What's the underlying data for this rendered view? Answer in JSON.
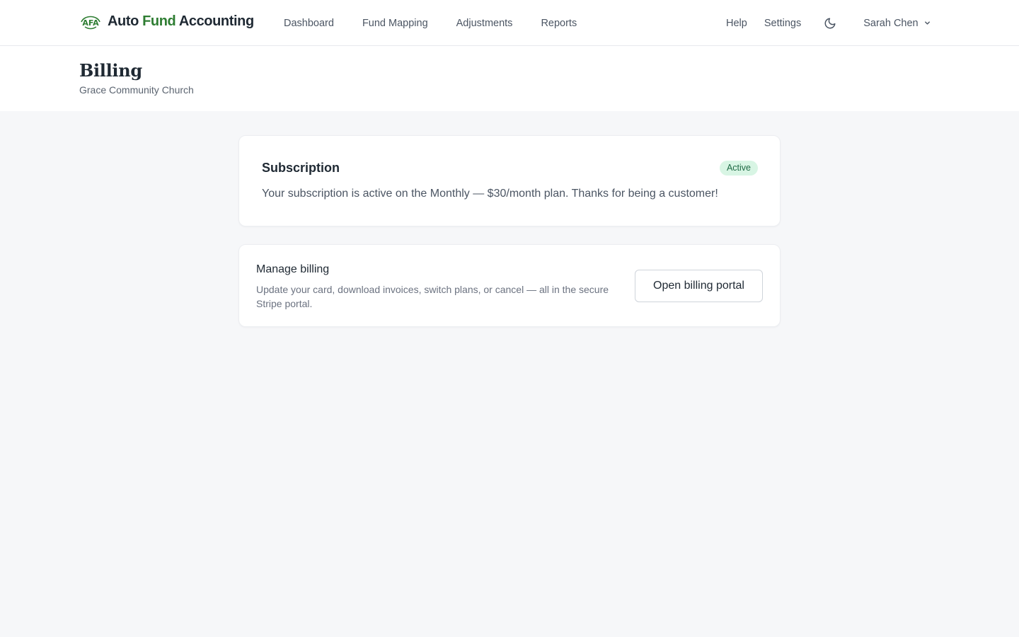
{
  "app": {
    "logo_mark": "AFA",
    "name_part1": "Auto",
    "name_part2": "Fund",
    "name_part3": "Accounting",
    "brand_color": "#2e7d32"
  },
  "nav": {
    "items": [
      {
        "label": "Dashboard"
      },
      {
        "label": "Fund Mapping"
      },
      {
        "label": "Adjustments"
      },
      {
        "label": "Reports"
      }
    ],
    "help_label": "Help",
    "settings_label": "Settings",
    "theme_icon": "moon-icon",
    "user_name": "Sarah Chen",
    "user_menu_icon": "chevron-down-icon"
  },
  "page": {
    "title": "Billing",
    "subtitle": "Grace Community Church"
  },
  "subscription": {
    "title": "Subscription",
    "status": "Active",
    "status_color": "#d8f5e4",
    "message": "Your subscription is active on the Monthly — $30/month plan. Thanks for being a customer!"
  },
  "billing": {
    "title": "Manage billing",
    "description": "Update your card, download invoices, switch plans, or cancel — all in the secure Stripe portal.",
    "button_label": "Open billing portal"
  }
}
